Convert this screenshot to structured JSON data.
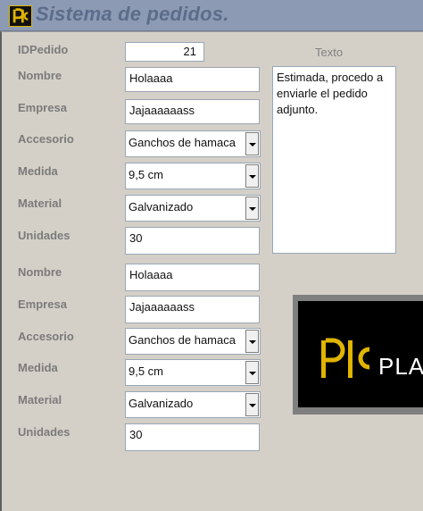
{
  "app": {
    "title": "Sistema de pedidos."
  },
  "form": {
    "id_label": "IDPedido",
    "id_value": "21",
    "texto_label": "Texto",
    "texto_value": "Estimada, procedo a enviarle el pedido adjunto.",
    "sections": [
      {
        "nombre_label": "Nombre",
        "nombre_value": "Holaaaa",
        "empresa_label": "Empresa",
        "empresa_value": "Jajaaaaaass",
        "accesorio_label": "Accesorio",
        "accesorio_value": "Ganchos de hamaca",
        "medida_label": "Medida",
        "medida_value": "9,5 cm",
        "material_label": "Material",
        "material_value": "Galvanizado",
        "unidades_label": "Unidades",
        "unidades_value": "30"
      },
      {
        "nombre_label": "Nombre",
        "nombre_value": "Holaaaa",
        "empresa_label": "Empresa",
        "empresa_value": "Jajaaaaaass",
        "accesorio_label": "Accesorio",
        "accesorio_value": "Ganchos de hamaca",
        "medida_label": "Medida",
        "medida_value": "9,5 cm",
        "material_label": "Material",
        "material_value": "Galvanizado",
        "unidades_label": "Unidades",
        "unidades_value": "30"
      }
    ]
  },
  "banner": {
    "text": "PLA"
  },
  "colors": {
    "header": "#8c9bb3",
    "title": "#5b6d8a",
    "logo_accent": "#e0b400",
    "background": "#d4d0c8"
  },
  "icons": {
    "logo": "company-logo-icon",
    "dropdown": "chevron-down-icon"
  }
}
